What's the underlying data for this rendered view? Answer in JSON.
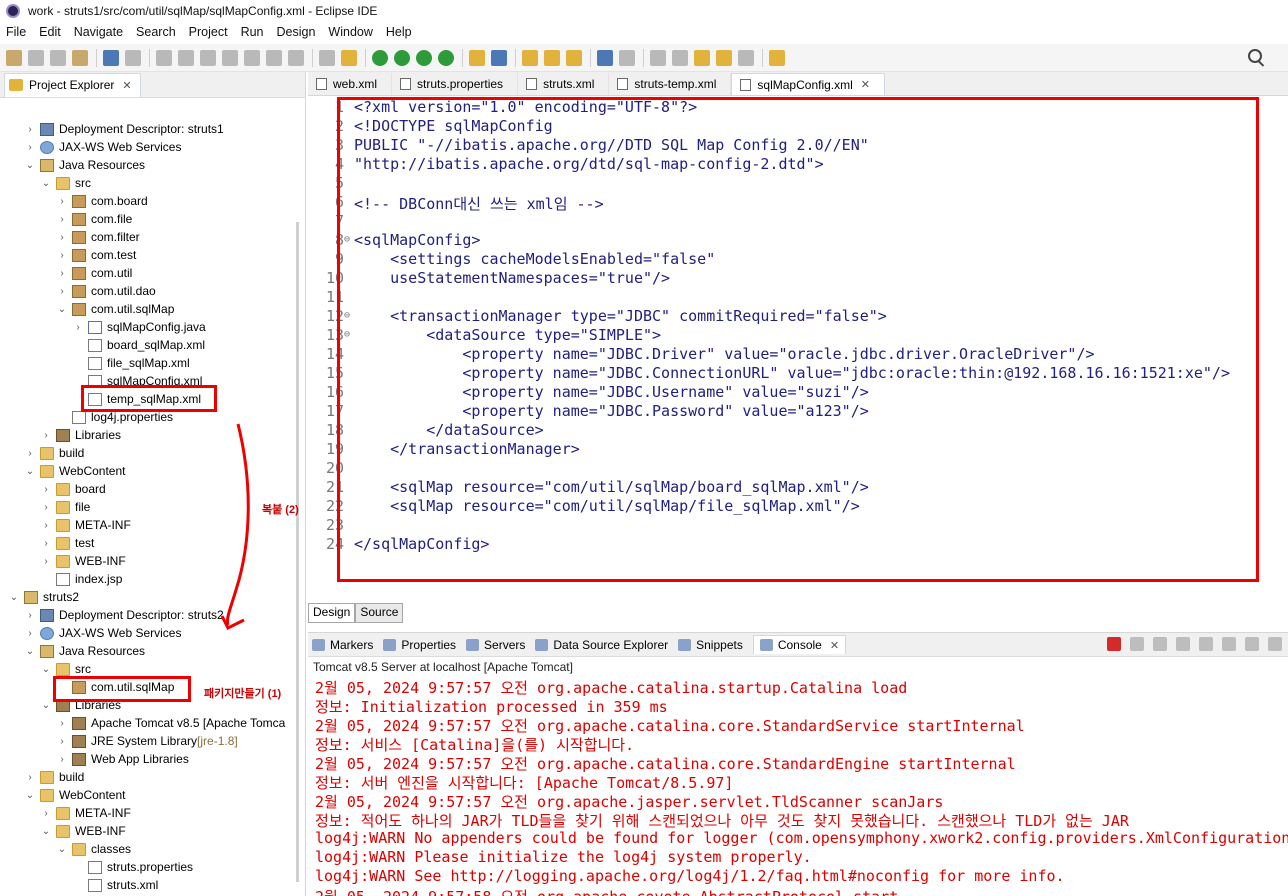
{
  "window": {
    "title": "work - struts1/src/com/util/sqlMap/sqlMapConfig.xml - Eclipse IDE"
  },
  "menu": [
    "File",
    "Edit",
    "Navigate",
    "Search",
    "Project",
    "Run",
    "Design",
    "Window",
    "Help"
  ],
  "project_explorer": {
    "title": "Project Explorer",
    "tree": [
      {
        "label": "Deployment Descriptor: struts1",
        "indent": 1,
        "icon": "desc",
        "chev": ">"
      },
      {
        "label": "JAX-WS Web Services",
        "indent": 1,
        "icon": "ws",
        "chev": ">"
      },
      {
        "label": "Java Resources",
        "indent": 1,
        "icon": "proj",
        "chev": "v"
      },
      {
        "label": "src",
        "indent": 2,
        "icon": "folder",
        "chev": "v"
      },
      {
        "label": "com.board",
        "indent": 3,
        "icon": "pkg",
        "chev": ">"
      },
      {
        "label": "com.file",
        "indent": 3,
        "icon": "pkg",
        "chev": ">"
      },
      {
        "label": "com.filter",
        "indent": 3,
        "icon": "pkg",
        "chev": ">"
      },
      {
        "label": "com.test",
        "indent": 3,
        "icon": "pkg",
        "chev": ">"
      },
      {
        "label": "com.util",
        "indent": 3,
        "icon": "pkg",
        "chev": ">"
      },
      {
        "label": "com.util.dao",
        "indent": 3,
        "icon": "pkg",
        "chev": ">"
      },
      {
        "label": "com.util.sqlMap",
        "indent": 3,
        "icon": "pkg",
        "chev": "v"
      },
      {
        "label": "sqlMapConfig.java",
        "indent": 4,
        "icon": "jfile",
        "chev": ">"
      },
      {
        "label": "board_sqlMap.xml",
        "indent": 4,
        "icon": "file",
        "chev": ""
      },
      {
        "label": "file_sqlMap.xml",
        "indent": 4,
        "icon": "file",
        "chev": ""
      },
      {
        "label": "sqlMapConfig.xml",
        "indent": 4,
        "icon": "file",
        "chev": ""
      },
      {
        "label": "temp_sqlMap.xml",
        "indent": 4,
        "icon": "file",
        "chev": ""
      },
      {
        "label": "log4j.properties",
        "indent": 3,
        "icon": "file",
        "chev": ""
      },
      {
        "label": "Libraries",
        "indent": 2,
        "icon": "lib",
        "chev": ">"
      },
      {
        "label": "build",
        "indent": 1,
        "icon": "folder",
        "chev": ">"
      },
      {
        "label": "WebContent",
        "indent": 1,
        "icon": "folder",
        "chev": "v"
      },
      {
        "label": "board",
        "indent": 2,
        "icon": "folder",
        "chev": ">"
      },
      {
        "label": "file",
        "indent": 2,
        "icon": "folder",
        "chev": ">"
      },
      {
        "label": "META-INF",
        "indent": 2,
        "icon": "folder",
        "chev": ">"
      },
      {
        "label": "test",
        "indent": 2,
        "icon": "folder",
        "chev": ">"
      },
      {
        "label": "WEB-INF",
        "indent": 2,
        "icon": "folder",
        "chev": ">"
      },
      {
        "label": "index.jsp",
        "indent": 2,
        "icon": "file",
        "chev": ""
      },
      {
        "label": "struts2",
        "indent": 0,
        "icon": "proj",
        "chev": "v"
      },
      {
        "label": "Deployment Descriptor: struts2",
        "indent": 1,
        "icon": "desc",
        "chev": ">"
      },
      {
        "label": "JAX-WS Web Services",
        "indent": 1,
        "icon": "ws",
        "chev": ">"
      },
      {
        "label": "Java Resources",
        "indent": 1,
        "icon": "proj",
        "chev": "v"
      },
      {
        "label": "src",
        "indent": 2,
        "icon": "folder",
        "chev": "v"
      },
      {
        "label": "com.util.sqlMap",
        "indent": 3,
        "icon": "pkg",
        "chev": ""
      },
      {
        "label": "Libraries",
        "indent": 2,
        "icon": "lib",
        "chev": "v"
      },
      {
        "label": "Apache Tomcat v8.5 [Apache Tomca",
        "indent": 3,
        "icon": "lib",
        "chev": ">"
      },
      {
        "label": "JRE System Library",
        "suffix": " [jre-1.8]",
        "indent": 3,
        "icon": "lib",
        "chev": ">"
      },
      {
        "label": "Web App Libraries",
        "indent": 3,
        "icon": "lib",
        "chev": ">"
      },
      {
        "label": "build",
        "indent": 1,
        "icon": "folder",
        "chev": ">"
      },
      {
        "label": "WebContent",
        "indent": 1,
        "icon": "folder",
        "chev": "v"
      },
      {
        "label": "META-INF",
        "indent": 2,
        "icon": "folder",
        "chev": ">"
      },
      {
        "label": "WEB-INF",
        "indent": 2,
        "icon": "folder",
        "chev": "v"
      },
      {
        "label": "classes",
        "indent": 3,
        "icon": "folder",
        "chev": "v"
      },
      {
        "label": "struts.properties",
        "indent": 4,
        "icon": "file",
        "chev": ""
      },
      {
        "label": "struts.xml",
        "indent": 4,
        "icon": "file",
        "chev": ""
      }
    ]
  },
  "editor": {
    "tabs": [
      {
        "label": "web.xml",
        "active": false
      },
      {
        "label": "struts.properties",
        "active": false
      },
      {
        "label": "struts.xml",
        "active": false
      },
      {
        "label": "struts-temp.xml",
        "active": false
      },
      {
        "label": "sqlMapConfig.xml",
        "active": true
      }
    ],
    "lines": [
      {
        "n": "1",
        "t": "<?xml version=\"1.0\" encoding=\"UTF-8\"?>"
      },
      {
        "n": "2",
        "t": "<!DOCTYPE sqlMapConfig"
      },
      {
        "n": "3",
        "t": "PUBLIC \"-//ibatis.apache.org//DTD SQL Map Config 2.0//EN\""
      },
      {
        "n": "4",
        "t": "\"http://ibatis.apache.org/dtd/sql-map-config-2.dtd\">"
      },
      {
        "n": "5",
        "t": ""
      },
      {
        "n": "6",
        "t": "<!-- DBConn대신 쓰는 xml임 -->"
      },
      {
        "n": "7",
        "t": ""
      },
      {
        "n": "8",
        "t": "<sqlMapConfig>"
      },
      {
        "n": "9",
        "t": "    <settings cacheModelsEnabled=\"false\""
      },
      {
        "n": "10",
        "t": "    useStatementNamespaces=\"true\"/>"
      },
      {
        "n": "11",
        "t": ""
      },
      {
        "n": "12",
        "t": "    <transactionManager type=\"JDBC\" commitRequired=\"false\">"
      },
      {
        "n": "13",
        "t": "        <dataSource type=\"SIMPLE\">"
      },
      {
        "n": "14",
        "t": "            <property name=\"JDBC.Driver\" value=\"oracle.jdbc.driver.OracleDriver\"/>"
      },
      {
        "n": "15",
        "t": "            <property name=\"JDBC.ConnectionURL\" value=\"jdbc:oracle:thin:@192.168.16.16:1521:xe\"/>"
      },
      {
        "n": "16",
        "t": "            <property name=\"JDBC.Username\" value=\"suzi\"/>"
      },
      {
        "n": "17",
        "t": "            <property name=\"JDBC.Password\" value=\"a123\"/>"
      },
      {
        "n": "18",
        "t": "        </dataSource>"
      },
      {
        "n": "19",
        "t": "    </transactionManager>"
      },
      {
        "n": "20",
        "t": ""
      },
      {
        "n": "21",
        "t": "    <sqlMap resource=\"com/util/sqlMap/board_sqlMap.xml\"/>"
      },
      {
        "n": "22",
        "t": "    <sqlMap resource=\"com/util/sqlMap/file_sqlMap.xml\"/>"
      },
      {
        "n": "23",
        "t": ""
      },
      {
        "n": "24",
        "t": "</sqlMapConfig>"
      }
    ],
    "design_tab": "Design",
    "source_tab": "Source"
  },
  "console": {
    "tabs": [
      {
        "label": "Markers",
        "active": false
      },
      {
        "label": "Properties",
        "active": false
      },
      {
        "label": "Servers",
        "active": false
      },
      {
        "label": "Data Source Explorer",
        "active": false
      },
      {
        "label": "Snippets",
        "active": false
      },
      {
        "label": "Console",
        "active": true
      }
    ],
    "status": "Tomcat v8.5 Server at localhost [Apache Tomcat]",
    "lines": [
      "2월 05, 2024 9:57:57 오전 org.apache.catalina.startup.Catalina load",
      "정보: Initialization processed in 359 ms",
      "2월 05, 2024 9:57:57 오전 org.apache.catalina.core.StandardService startInternal",
      "정보: 서비스 [Catalina]을(를) 시작합니다.",
      "2월 05, 2024 9:57:57 오전 org.apache.catalina.core.StandardEngine startInternal",
      "정보: 서버 엔진을 시작합니다: [Apache Tomcat/8.5.97]",
      "2월 05, 2024 9:57:57 오전 org.apache.jasper.servlet.TldScanner scanJars",
      "정보: 적어도 하나의 JAR가 TLD들을 찾기 위해 스캔되었으나 아무 것도 찾지 못했습니다. 스캔했으나 TLD가 없는 JAR",
      "log4j:WARN No appenders could be found for logger (com.opensymphony.xwork2.config.providers.XmlConfiguration",
      "log4j:WARN Please initialize the log4j system properly.",
      "log4j:WARN See http://logging.apache.org/log4j/1.2/faq.html#noconfig for more info.",
      "2월 05, 2024 9:57:58 오전 org.apache.coyote.AbstractProtocol start"
    ]
  },
  "annotations": {
    "copy_label": "복붙 (2)",
    "make_package_label": "패키지만들기  (1)"
  },
  "colors": {
    "annotation": "#e00000",
    "console_text": "#d00000",
    "string_value": "#2a00ff",
    "tag": "#1f2bb0"
  }
}
